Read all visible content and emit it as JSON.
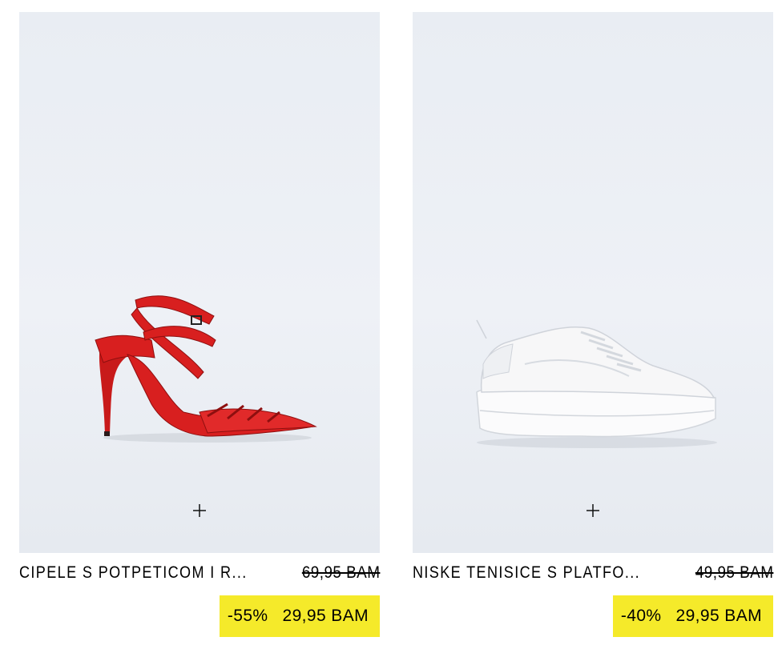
{
  "products": [
    {
      "name": "CIPELE S POTPETICOM I R...",
      "old_price": "69,95 BAM",
      "discount": "-55%",
      "price": "29,95 BAM",
      "image_icon": "red-heel-shoe-image",
      "add_icon": "plus-icon"
    },
    {
      "name": "NISKE TENISICE S PLATFO...",
      "old_price": "49,95 BAM",
      "discount": "-40%",
      "price": "29,95 BAM",
      "image_icon": "white-sneaker-image",
      "add_icon": "plus-icon"
    }
  ],
  "colors": {
    "sale_highlight": "#f5ea2a",
    "image_background": "#eceff4",
    "shoe_red": "#d81f1f",
    "sneaker_white": "#f7f7f8"
  }
}
